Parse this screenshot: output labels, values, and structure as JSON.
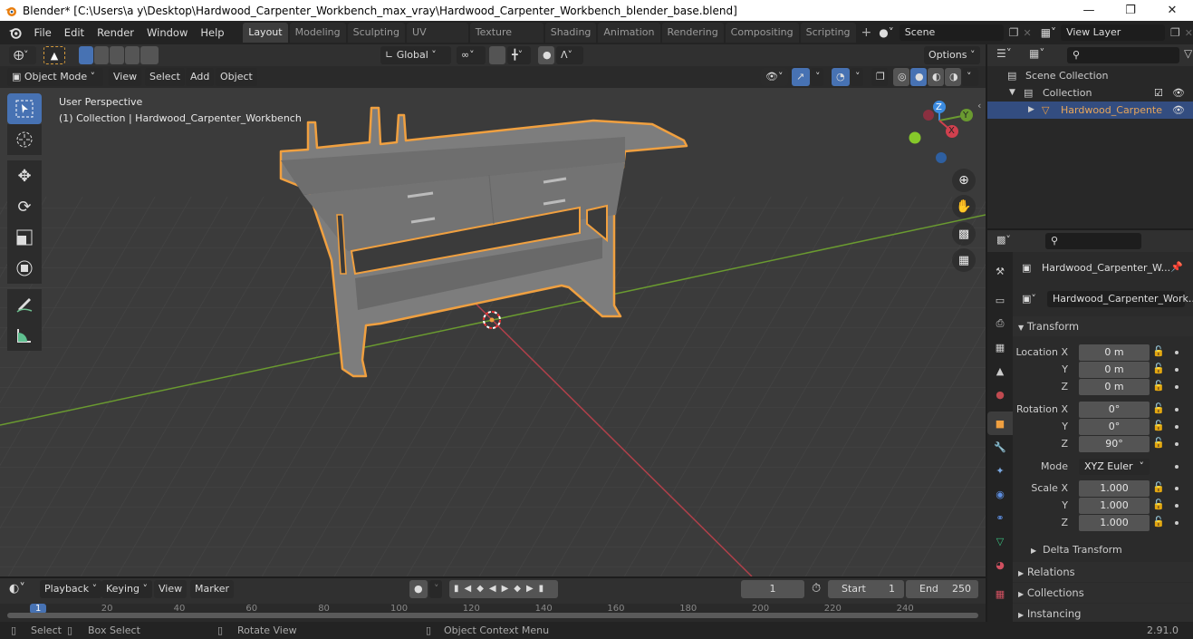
{
  "window": {
    "title": "Blender* [C:\\Users\\a y\\Desktop\\Hardwood_Carpenter_Workbench_max_vray\\Hardwood_Carpenter_Workbench_blender_base.blend]",
    "controls": [
      "minimize",
      "maximize",
      "close"
    ]
  },
  "menu": {
    "items": [
      "File",
      "Edit",
      "Render",
      "Window",
      "Help"
    ]
  },
  "workspaces": {
    "tabs": [
      "Layout",
      "Modeling",
      "Sculpting",
      "UV Editing",
      "Texture Paint",
      "Shading",
      "Animation",
      "Rendering",
      "Compositing",
      "Scripting"
    ],
    "active": "Layout",
    "add_label": "+"
  },
  "scene": {
    "name": "Scene",
    "view_layer": "View Layer"
  },
  "viewport_header": {
    "orientation": "Global",
    "options_label": "Options",
    "mode": "Object Mode",
    "menus": [
      "View",
      "Select",
      "Add",
      "Object"
    ]
  },
  "viewport": {
    "perspective": "User Perspective",
    "context": "(1) Collection | Hardwood_Carpenter_Workbench",
    "gizmo": {
      "z": "Z",
      "y": "Y",
      "x": "X"
    },
    "colors": {
      "selection_outline": "#f0a040",
      "x_axis": "#d0404e",
      "y_axis": "#6a9a30",
      "z_axis": "#3b8be0"
    }
  },
  "outliner": {
    "rows": [
      {
        "label": "Scene Collection",
        "icon": "scene-collection-icon"
      },
      {
        "label": "Collection",
        "icon": "collection-icon"
      },
      {
        "label": "Hardwood_Carpente",
        "icon": "mesh-object-icon",
        "selected": true
      }
    ]
  },
  "properties": {
    "object_name": "Hardwood_Carpenter_W...",
    "datablock_name": "Hardwood_Carpenter_Work...",
    "transform_label": "Transform",
    "location": {
      "label": "Location X",
      "x": "0 m",
      "y": "0 m",
      "z": "0 m"
    },
    "rotation": {
      "label": "Rotation X",
      "x": "0°",
      "y": "0°",
      "z": "90°"
    },
    "mode_label": "Mode",
    "mode_value": "XYZ Euler",
    "scale": {
      "label": "Scale X",
      "x": "1.000",
      "y": "1.000",
      "z": "1.000"
    },
    "axis_y": "Y",
    "axis_z": "Z",
    "subpanels": [
      "Delta Transform"
    ],
    "panels": [
      "Relations",
      "Collections",
      "Instancing"
    ]
  },
  "timeline": {
    "menus": [
      "Playback",
      "Keying",
      "View",
      "Marker"
    ],
    "current_frame": "1",
    "start_label": "Start",
    "start": "1",
    "end_label": "End",
    "end": "250",
    "ruler": [
      "1",
      "20",
      "40",
      "60",
      "80",
      "100",
      "120",
      "140",
      "160",
      "180",
      "200",
      "220",
      "240"
    ]
  },
  "status": {
    "hints": [
      "Select",
      "Box Select",
      "Rotate View",
      "Object Context Menu"
    ],
    "version": "2.91.0"
  }
}
